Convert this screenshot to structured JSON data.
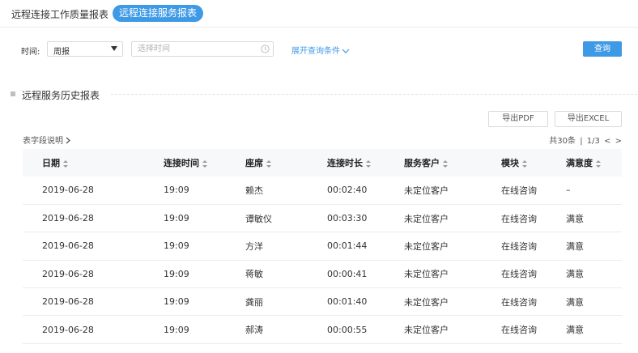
{
  "tabs": [
    {
      "label": "远程连接工作质量报表",
      "active": false
    },
    {
      "label": "远程连接服务报表",
      "active": true
    }
  ],
  "filter": {
    "time_label": "时间:",
    "period_value": "周报",
    "date_placeholder": "选择时间",
    "expand_label": "展开查询条件",
    "query_label": "查询"
  },
  "section": {
    "title": "远程服务历史报表",
    "export_pdf": "导出PDF",
    "export_excel": "导出EXCEL",
    "field_desc": "表字段说明",
    "total": "共30条",
    "separator": "|",
    "page": "1/3",
    "prev": "<",
    "next": ">"
  },
  "table": {
    "headers": [
      "日期",
      "连接时间",
      "座席",
      "连接时长",
      "服务客户",
      "模块",
      "满意度"
    ],
    "rows": [
      [
        "2019-06-28",
        "19:09",
        "赖杰",
        "00:02:40",
        "未定位客户",
        "在线咨询",
        "–"
      ],
      [
        "2019-06-28",
        "19:09",
        "谭敏仪",
        "00:03:30",
        "未定位客户",
        "在线咨询",
        "满意"
      ],
      [
        "2019-06-28",
        "19:09",
        "方洋",
        "00:01:44",
        "未定位客户",
        "在线咨询",
        "满意"
      ],
      [
        "2019-06-28",
        "19:09",
        "蒋敏",
        "00:00:41",
        "未定位客户",
        "在线咨询",
        "满意"
      ],
      [
        "2019-06-28",
        "19:09",
        "龚丽",
        "00:01:40",
        "未定位客户",
        "在线咨询",
        "满意"
      ],
      [
        "2019-06-28",
        "19:09",
        "郝涛",
        "00:00:55",
        "未定位客户",
        "在线咨询",
        "满意"
      ]
    ]
  },
  "colors": {
    "accent": "#3f9ae6",
    "header_bg": "#f7f8fa"
  },
  "icons": {
    "select_arrow": "caret-down-icon",
    "date": "clock-icon",
    "expand": "chevron-down-icon",
    "field_desc": "chevron-right-icon",
    "sort": "sort-icon"
  }
}
